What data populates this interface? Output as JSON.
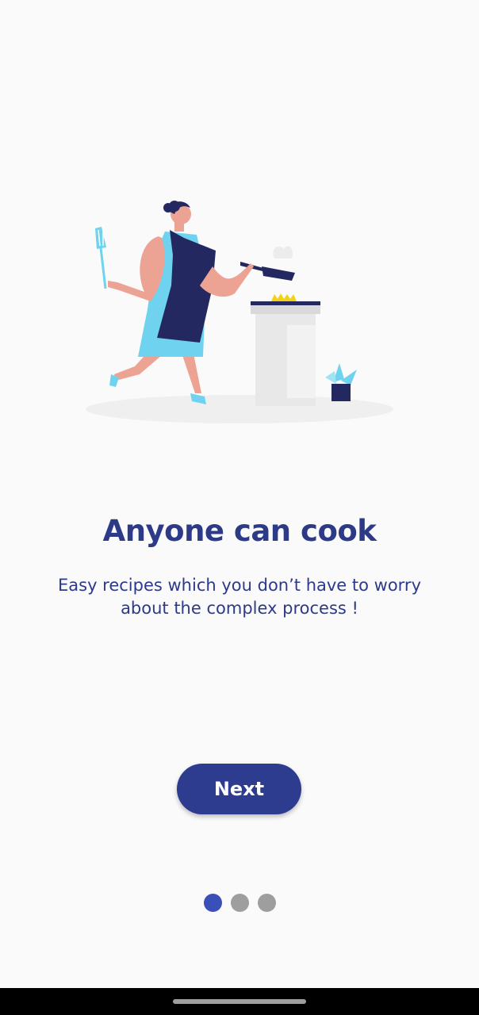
{
  "onboarding": {
    "title": "Anyone can cook",
    "description": "Easy recipes which you don’t have to worry about the complex process !",
    "next_label": "Next",
    "page_indicator": {
      "total": 3,
      "current": 1
    }
  },
  "colors": {
    "background": "#fafafa",
    "primary": "#2e3c8f",
    "text": "#2d3a87",
    "dot_active": "#3b4fb8",
    "dot_inactive": "#9e9e9e"
  },
  "illustration": {
    "icon": "woman-cooking-illustration"
  }
}
